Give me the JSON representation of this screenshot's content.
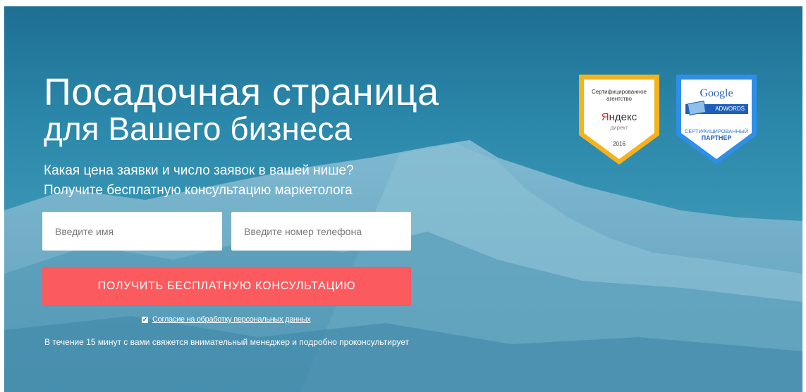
{
  "hero": {
    "title_line1": "Посадочная страница",
    "title_line2": "для Вашего бизнеса",
    "subtitle_line1": "Какая цена заявки и число заявок в вашей нише?",
    "subtitle_line2": "Получите бесплатную консультацию маркетолога"
  },
  "form": {
    "name_placeholder": "Введите имя",
    "phone_placeholder": "Введите номер телефона",
    "submit_label": "ПОЛУЧИТЬ БЕСПЛАТНУЮ КОНСУЛЬТАЦИЮ",
    "consent_checked": true,
    "consent_label": "Согласие на обработку персональных данных",
    "note": "В течение 15 минут с вами свяжется внимательный менеджер и подробно проконсультирует"
  },
  "badges": {
    "yandex": {
      "line1": "Сертифицированное",
      "line2": "агентство",
      "logo_first": "Я",
      "logo_rest": "ндекс",
      "sub": "директ",
      "year": "2016"
    },
    "google": {
      "logo": "Google",
      "bar": "ADWORDS",
      "line1": "СЕРТИФИЦИРОВАННЫЙ",
      "line2": "ПАРТНЕР"
    }
  },
  "colors": {
    "cta": "#fb5a5e",
    "sky_top": "#1e6f93",
    "sky_bottom": "#5aa5c0",
    "yandex_badge_border": "#f5b21d",
    "google_badge_border": "#2e8ee8"
  }
}
